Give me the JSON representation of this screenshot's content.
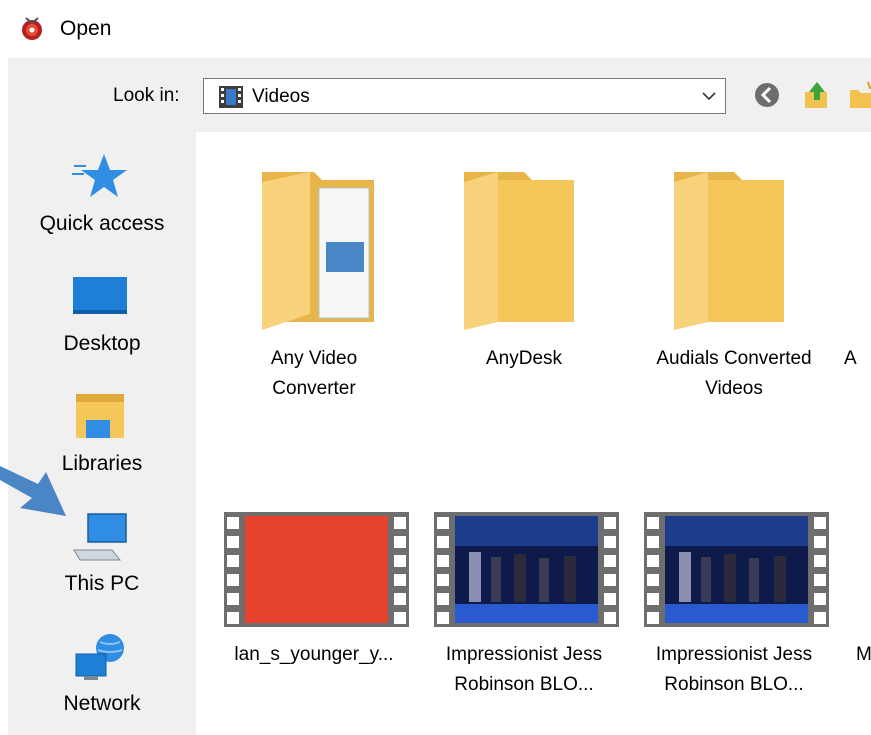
{
  "window": {
    "title": "Open"
  },
  "toolbar": {
    "lookin_label": "Look in:",
    "lookin_value": "Videos"
  },
  "places": [
    {
      "label": "Quick access",
      "icon": "star-icon"
    },
    {
      "label": "Desktop",
      "icon": "desktop-icon"
    },
    {
      "label": "Libraries",
      "icon": "libraries-icon"
    },
    {
      "label": "This PC",
      "icon": "computer-icon"
    },
    {
      "label": "Network",
      "icon": "network-icon"
    }
  ],
  "items": [
    {
      "label": "Any Video\nConverter",
      "type": "folder"
    },
    {
      "label": "AnyDesk",
      "type": "folder"
    },
    {
      "label": "Audials Converted\nVideos",
      "type": "folder"
    },
    {
      "label": "A",
      "type": "folder"
    },
    {
      "label": "lan_s_younger_y...",
      "type": "video"
    },
    {
      "label": "Impressionist Jess\nRobinson BLO...",
      "type": "video"
    },
    {
      "label": "Impressionist Jess\nRobinson BLO...",
      "type": "video"
    },
    {
      "label": "M",
      "type": "video"
    }
  ],
  "colors": {
    "accent": "#4a90d9",
    "folder": "#f5c65a",
    "sidebar": "#f0f0f0",
    "highlight_arrow": "#4a86c5"
  }
}
